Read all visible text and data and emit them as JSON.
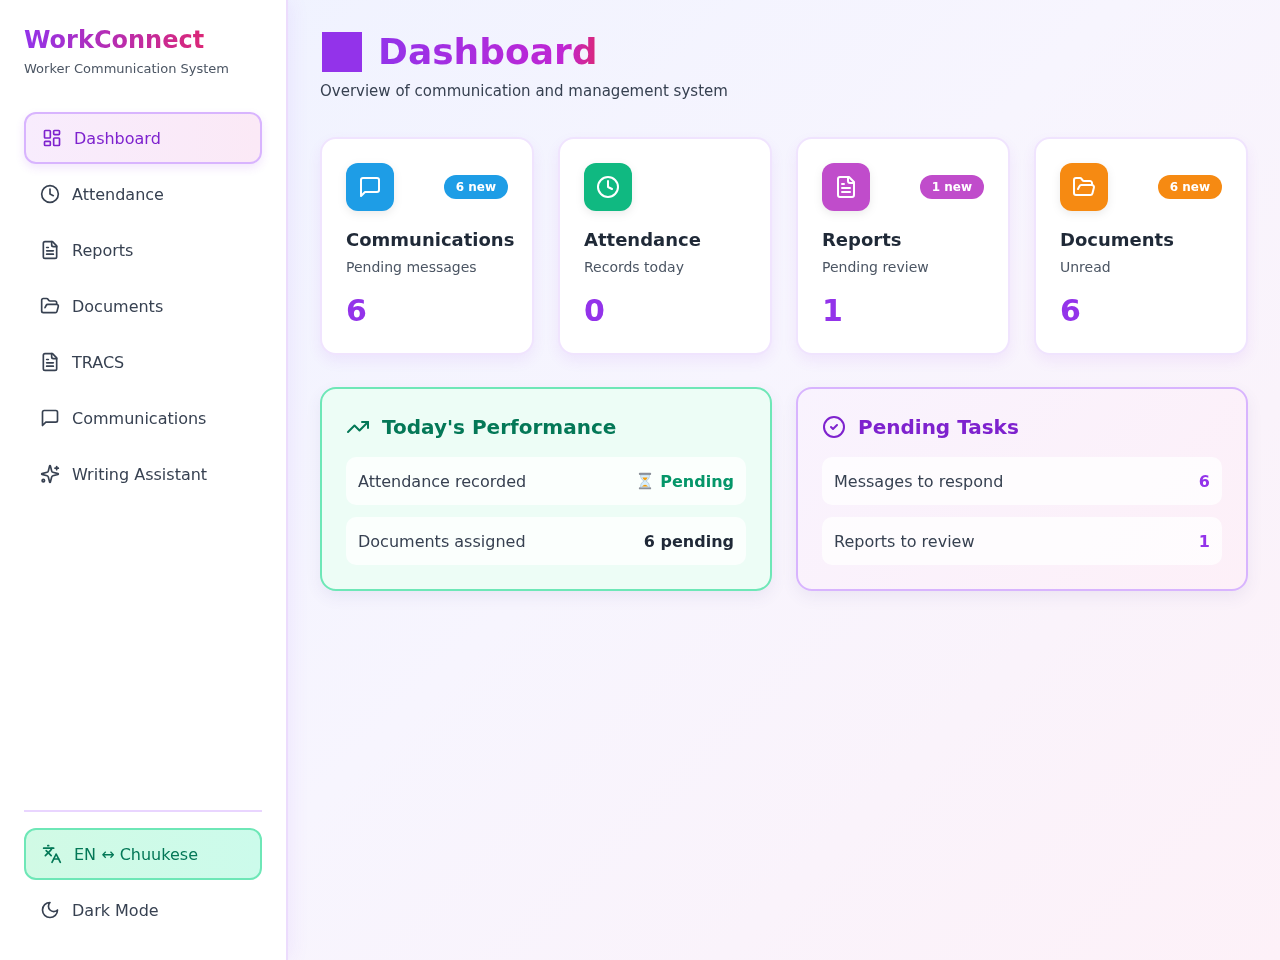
{
  "sidebar": {
    "logo": "WorkConnect",
    "tagline": "Worker Communication System",
    "nav_items": [
      {
        "label": "Dashboard",
        "kind": "grid",
        "selected": true
      },
      {
        "label": "Attendance",
        "kind": "clock",
        "selected": false
      },
      {
        "label": "Reports",
        "kind": "file",
        "selected": false
      },
      {
        "label": "Documents",
        "kind": "folder",
        "selected": false
      },
      {
        "label": "TRACS",
        "kind": "file",
        "selected": false
      },
      {
        "label": "Communications",
        "kind": "chat",
        "selected": false
      },
      {
        "label": "Writing Assistant",
        "kind": "sparkle",
        "selected": false
      }
    ],
    "language_toggle": {
      "label": "EN ↔ Chuukese"
    },
    "theme_toggle": {
      "label": "Dark Mode"
    }
  },
  "header": {
    "title": "Dashboard",
    "subtitle": "Overview of communication and management system"
  },
  "stat_cards": [
    {
      "kind": "chat",
      "title": "Communications",
      "caption": "Pending messages",
      "value": "6",
      "badge": "6 new",
      "color": "#1e9de6"
    },
    {
      "kind": "clock",
      "title": "Attendance",
      "caption": "Records today",
      "value": "0",
      "color": "#10b981"
    },
    {
      "kind": "file",
      "title": "Reports",
      "caption": "Pending review",
      "value": "1",
      "badge": "1 new",
      "color": "#c04ccb"
    },
    {
      "kind": "folder",
      "title": "Documents",
      "caption": "Unread",
      "value": "6",
      "badge": "6 new",
      "color": "#f68a12"
    }
  ],
  "performance_panel": {
    "title": "Today's Performance",
    "rows": [
      {
        "kind": "status",
        "label": "Attendance recorded",
        "value": "Pending"
      },
      {
        "kind": "count",
        "label": "Documents assigned",
        "value": "6 pending"
      }
    ]
  },
  "tasks_panel": {
    "title": "Pending Tasks",
    "rows": [
      {
        "label": "Messages to respond",
        "value": "6"
      },
      {
        "label": "Reports to review",
        "value": "1"
      }
    ]
  }
}
